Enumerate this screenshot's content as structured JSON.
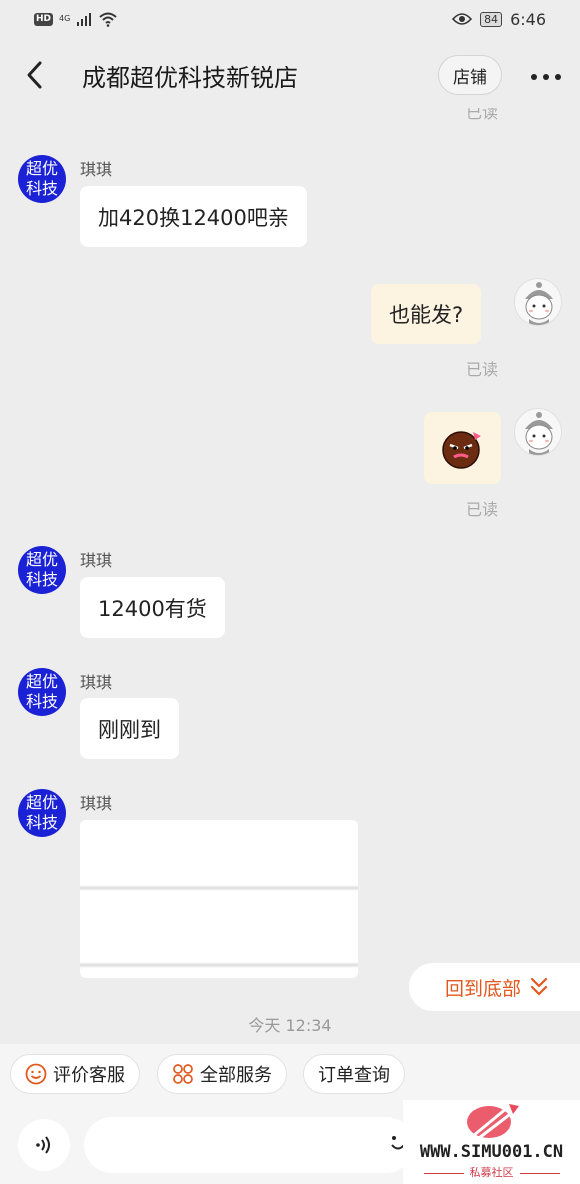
{
  "status_bar": {
    "hd": "HD",
    "network": "4G",
    "time": "6:46",
    "battery": "84"
  },
  "header": {
    "title": "成都超优科技新锐店",
    "shop_button": "店铺"
  },
  "messages": {
    "top_read": "已读",
    "shop_avatar_line1": "超优",
    "shop_avatar_line2": "科技",
    "m1": {
      "sender": "琪琪",
      "text": "加420换12400吧亲"
    },
    "m2": {
      "text": "也能发?",
      "read": "已读"
    },
    "m3": {
      "read": "已读"
    },
    "m4": {
      "sender": "琪琪",
      "text": "12400有货"
    },
    "m5": {
      "sender": "琪琪",
      "text": "刚刚到"
    },
    "m6": {
      "sender": "琪琪"
    }
  },
  "back_to_bottom": "回到底部",
  "timestamp": "今天   12:34",
  "quick_actions": [
    {
      "label": "评价客服",
      "icon": "smile-icon"
    },
    {
      "label": "全部服务",
      "icon": "grid-icon"
    },
    {
      "label": "订单查询",
      "icon": ""
    }
  ],
  "input": {
    "placeholder": ""
  },
  "watermark": {
    "site": "WWW.SIMU001.CN",
    "subtitle": "私募社区"
  },
  "colors": {
    "accent": "#e2581e",
    "shop_avatar": "#1b22d6",
    "outgoing_bubble": "#fdf3e1"
  }
}
